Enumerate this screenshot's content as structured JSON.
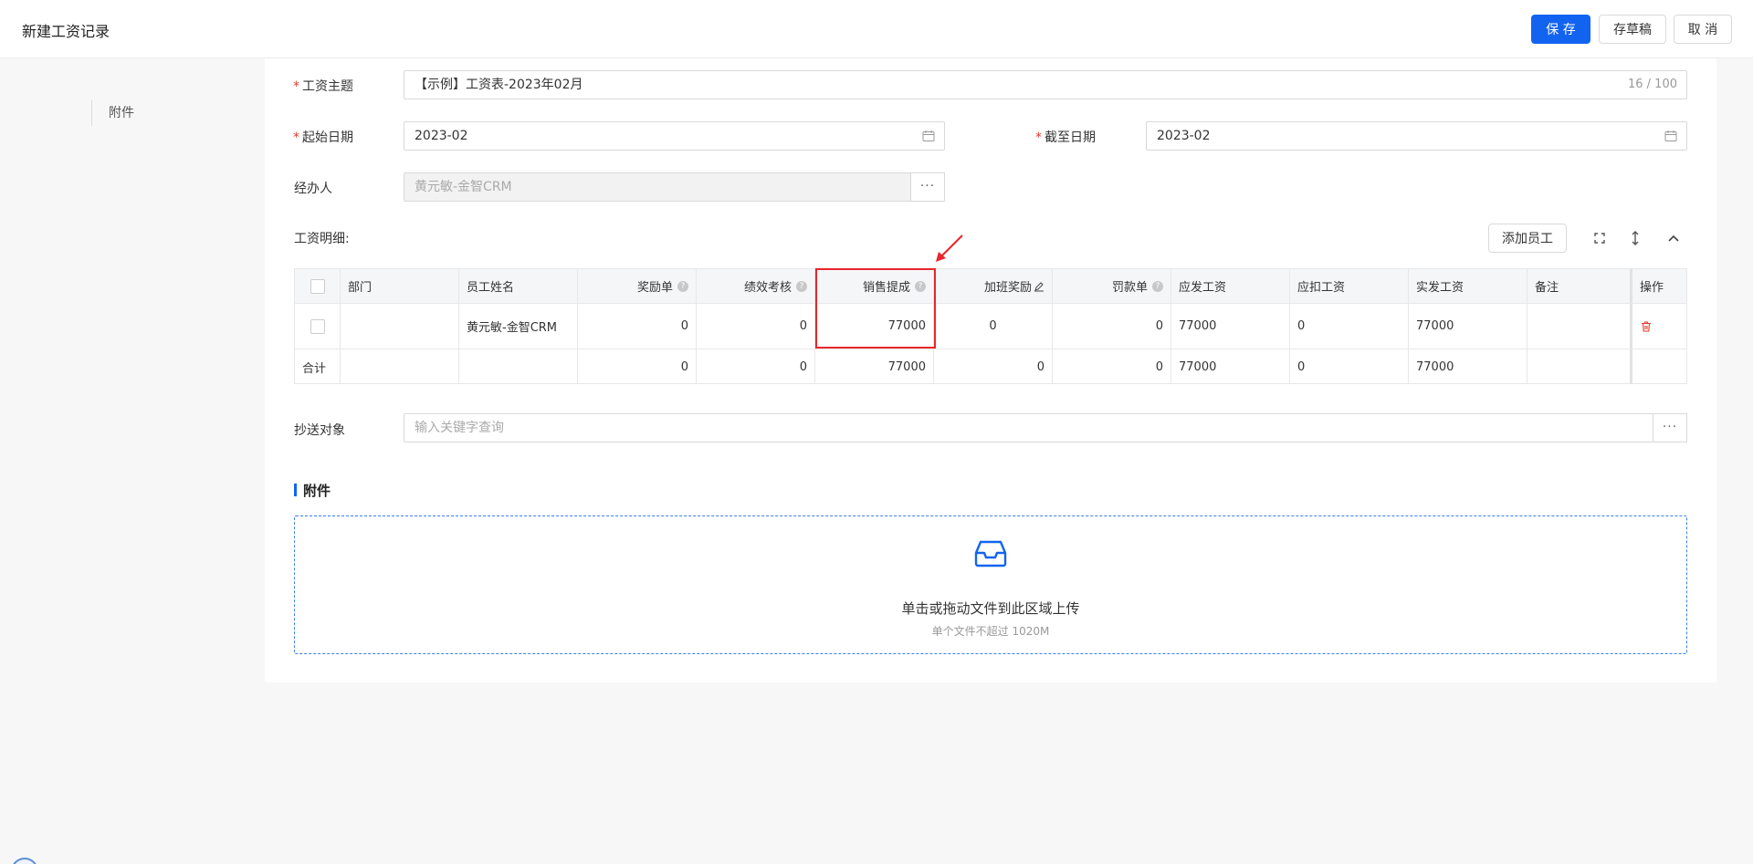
{
  "header": {
    "title": "新建工资记录",
    "save_label": "保 存",
    "draft_label": "存草稿",
    "cancel_label": "取 消"
  },
  "nav": {
    "items": [
      {
        "label": "附件"
      }
    ]
  },
  "form": {
    "subject_label": "工资主题",
    "subject_value": "【示例】工资表-2023年02月",
    "subject_count": "16 / 100",
    "start_label": "起始日期",
    "start_value": "2023-02",
    "end_label": "截至日期",
    "end_value": "2023-02",
    "handler_label": "经办人",
    "handler_value": "黄元敏-金智CRM",
    "more": "···"
  },
  "detail": {
    "title": "工资明细:",
    "add_employee_label": "添加员工",
    "columns": [
      "部门",
      "员工姓名",
      "奖励单",
      "绩效考核",
      "销售提成",
      "加班奖励",
      "罚款单",
      "应发工资",
      "应扣工资",
      "实发工资",
      "备注",
      "操作"
    ],
    "rows": [
      {
        "dept": "",
        "name": "黄元敏-金智CRM",
        "bonus": "0",
        "perf": "0",
        "sales": "77000",
        "overtime": "0",
        "fine": "0",
        "payable": "77000",
        "deduct": "0",
        "actual": "77000",
        "remark": ""
      }
    ],
    "total": {
      "label": "合计",
      "bonus": "0",
      "perf": "0",
      "sales": "77000",
      "overtime": "0",
      "fine": "0",
      "payable": "77000",
      "deduct": "0",
      "actual": "77000"
    }
  },
  "cc": {
    "label": "抄送对象",
    "placeholder": "输入关键字查询"
  },
  "attachment": {
    "title": "附件",
    "upload_text": "单击或拖动文件到此区域上传",
    "upload_hint": "单个文件不超过 1020M"
  },
  "colors": {
    "primary": "#1264f0",
    "required": "#e5382d",
    "highlight": "#e8262b",
    "delete": "#e5382d"
  }
}
